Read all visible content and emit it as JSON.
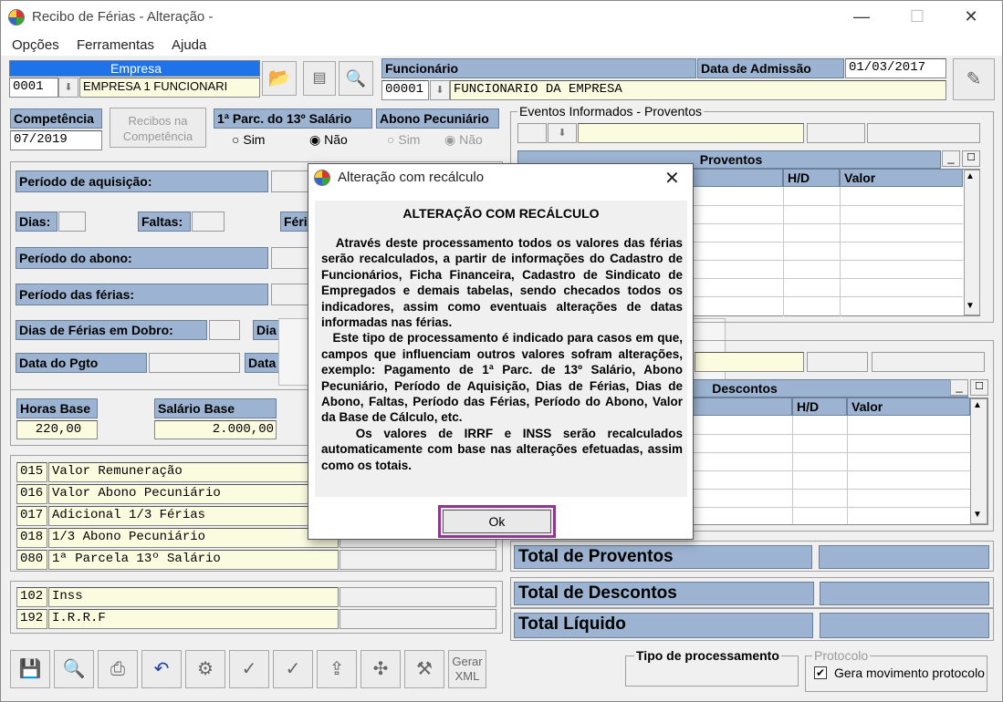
{
  "window": {
    "title": "Recibo de Férias - Alteração -"
  },
  "menu": [
    "Opções",
    "Ferramentas",
    "Ajuda"
  ],
  "empresa": {
    "label": "Empresa",
    "code": "0001",
    "name": "EMPRESA 1 FUNCIONARI"
  },
  "funcionario": {
    "label": "Funcionário",
    "code": "00001",
    "name": "FUNCIONARIO DA EMPRESA",
    "admissao_label": "Data de Admissão",
    "admissao": "01/03/2017"
  },
  "competencia": {
    "label": "Competência",
    "value": "07/2019",
    "recibos_btn": "Recibos na Competência"
  },
  "parc13": {
    "label": "1ª Parc. do 13º Salário",
    "sim": "Sim",
    "nao": "Não"
  },
  "abono": {
    "label": "Abono Pecuniário",
    "sim": "Sim",
    "nao": "Não"
  },
  "labels": {
    "periodo_aquisicao": "Período de aquisição:",
    "dias": "Dias:",
    "faltas": "Faltas:",
    "feri": "Féri",
    "periodo_abono": "Período do abono:",
    "periodo_ferias": "Período das férias:",
    "dias_dobro": "Dias de Férias em Dobro:",
    "dia": "Dia",
    "data_pgto": "Data do Pgto",
    "data": "Data",
    "horas_base": "Horas Base",
    "salario_base": "Salário Base"
  },
  "horas_base": "220,00",
  "salario_base": "2.000,00",
  "eventos": [
    {
      "code": "015",
      "desc": "Valor Remuneração"
    },
    {
      "code": "016",
      "desc": "Valor Abono Pecuniário"
    },
    {
      "code": "017",
      "desc": "Adicional 1/3 Férias"
    },
    {
      "code": "018",
      "desc": "1/3 Abono Pecuniário"
    },
    {
      "code": "080",
      "desc": "1ª Parcela 13º Salário"
    }
  ],
  "descontos_list": [
    {
      "code": "102",
      "desc": "Inss"
    },
    {
      "code": "192",
      "desc": "I.R.R.F"
    }
  ],
  "proventos": {
    "group": "Eventos Informados - Proventos",
    "title": "Proventos",
    "hd": "H/D",
    "valor": "Valor"
  },
  "descontos": {
    "title": "Descontos",
    "hd": "H/D",
    "valor": "Valor"
  },
  "totais": {
    "proventos": "Total de Proventos",
    "descontos": "Total de Descontos",
    "liquido": "Total Líquido"
  },
  "tipo_processamento": "Tipo de processamento",
  "protocolo": {
    "label": "Protocolo",
    "check": "Gera movimento protocolo",
    "checked": "✔"
  },
  "toolbar": {
    "gerar_xml": "Gerar XML"
  },
  "dialog": {
    "title": "Alteração com recálculo",
    "heading": "ALTERAÇÃO COM RECÁLCULO",
    "text": "   Através deste processamento todos os valores das férias serão recalculados, a partir de informações do Cadastro de Funcionários, Ficha Financeira, Cadastro de Sindicato de Empregados e demais tabelas, sendo checados todos os indicadores, assim como eventuais alterações de datas informadas nas férias.\n   Este tipo de processamento é indicado para casos em que, campos que influenciam outros valores sofram alterações, exemplo: Pagamento de 1ª Parc. de 13º Salário, Abono Pecuniário, Período de Aquisição, Dias de Férias, Dias de Abono, Faltas, Período das Férias, Período do Abono, Valor da Base de Cálculo, etc.\n   Os valores de IRRF e INSS serão recalculados automaticamente com base nas alterações efetuadas, assim como os totais.",
    "ok": "Ok"
  }
}
